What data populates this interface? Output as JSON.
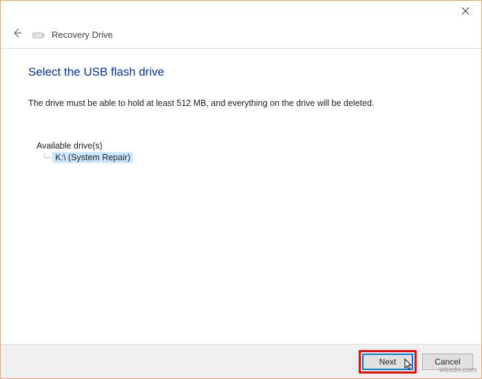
{
  "window": {
    "title": "Recovery Drive"
  },
  "page": {
    "heading": "Select the USB flash drive",
    "instruction": "The drive must be able to hold at least 512 MB, and everything on the drive will be deleted."
  },
  "drives": {
    "label": "Available drive(s)",
    "items": [
      {
        "label": "K:\\ (System Repair)",
        "selected": true
      }
    ]
  },
  "buttons": {
    "next": "Next",
    "cancel": "Cancel"
  },
  "watermark": "wsxdn.com"
}
